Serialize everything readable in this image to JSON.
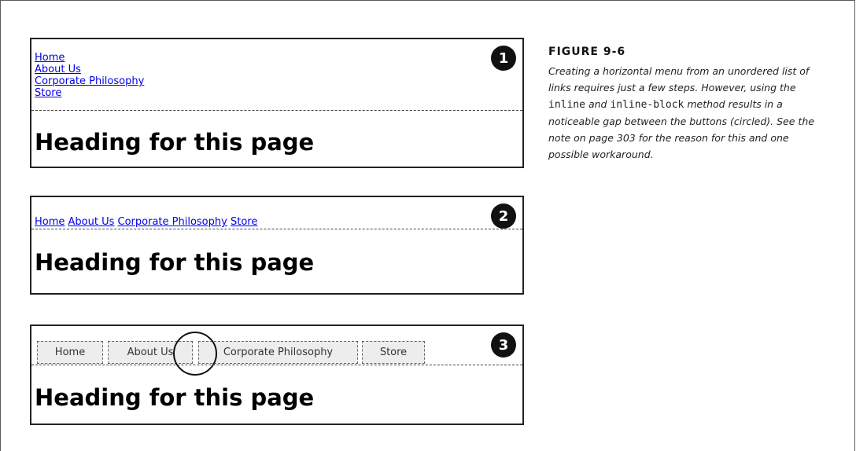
{
  "figure": {
    "label": "FIGURE 9-6",
    "caption_parts": [
      "Creating a horizontal menu from an unordered list of links requires just a few steps. However, using the ",
      "inline",
      " and ",
      "inline-block",
      " method results in a noticeable gap between the buttons (circled). See the note on page 303 for the reason for this and one possible workaround."
    ]
  },
  "panels": [
    {
      "badge": "1",
      "links": [
        "Home",
        "About Us",
        "Corporate Philosophy",
        "Store"
      ],
      "heading": "Heading for this page"
    },
    {
      "badge": "2",
      "links": [
        "Home",
        "About Us",
        "Corporate Philosophy",
        "Store"
      ],
      "heading": "Heading for this page"
    },
    {
      "badge": "3",
      "links": [
        "Home",
        "About Us",
        "Corporate Philosophy",
        "Store"
      ],
      "heading": "Heading for this page"
    }
  ]
}
